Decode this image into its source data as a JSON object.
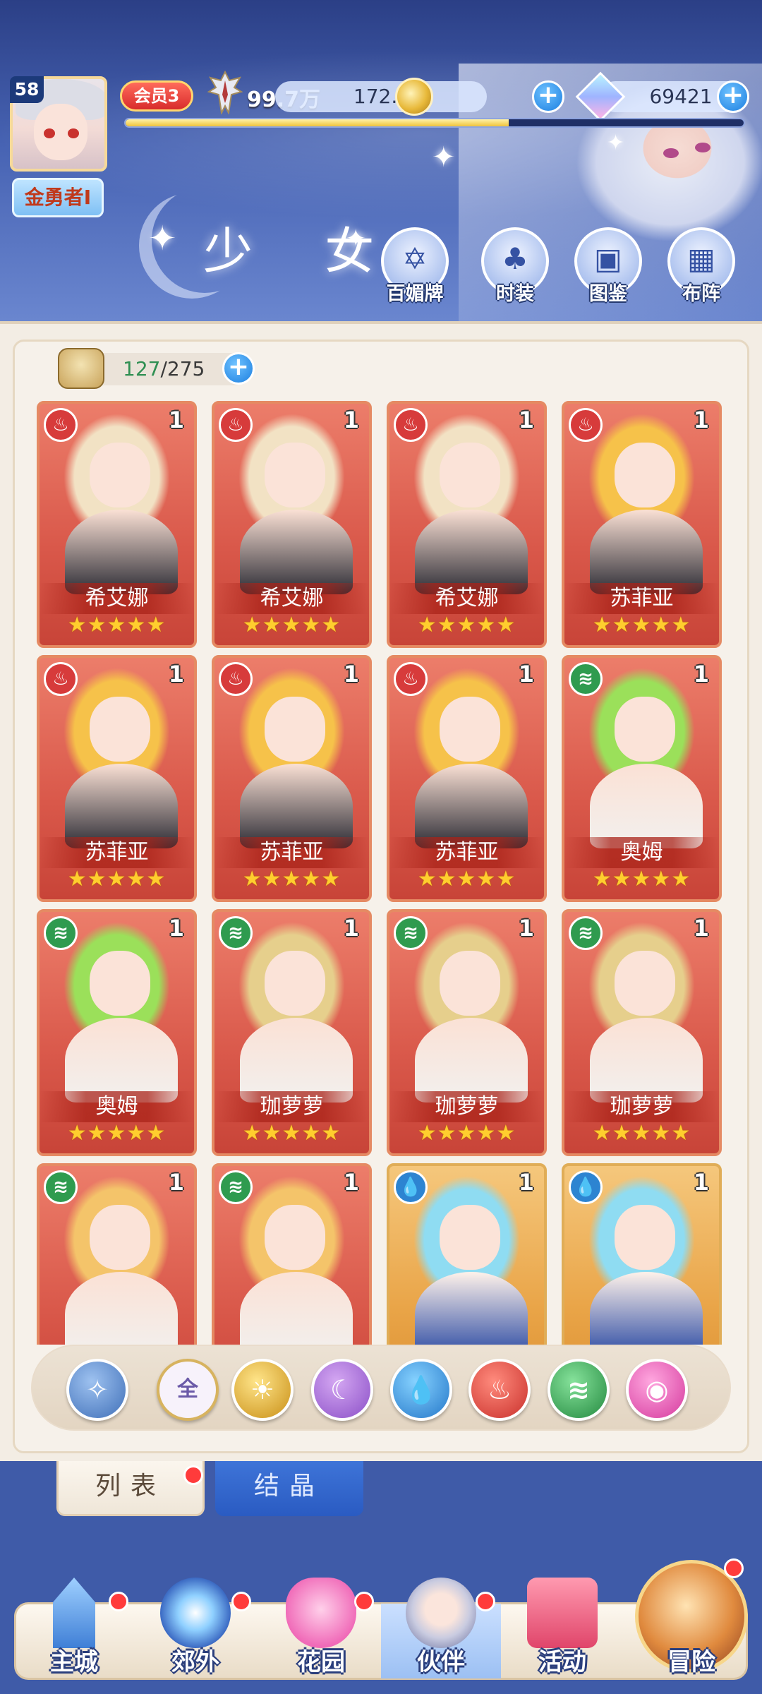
{
  "player": {
    "level": "58",
    "name": "金勇者I",
    "vip": "会员3",
    "power": "99.7万",
    "xp_fraction": 0.62
  },
  "currency": {
    "gold": "172.5万",
    "gems": "69421"
  },
  "section_title": "少 女",
  "features": [
    {
      "label": "百媚牌",
      "icon": "card-deck-icon"
    },
    {
      "label": "时装",
      "icon": "outfit-icon"
    },
    {
      "label": "图鉴",
      "icon": "album-icon"
    },
    {
      "label": "布阵",
      "icon": "formation-icon"
    }
  ],
  "inventory": {
    "current": "127",
    "max": "/275"
  },
  "cards": [
    {
      "name": "希艾娜",
      "element": "fire",
      "count": "1",
      "stars": "★★★★★",
      "style": "red",
      "hair": "#f2e2c4"
    },
    {
      "name": "希艾娜",
      "element": "fire",
      "count": "1",
      "stars": "★★★★★",
      "style": "red",
      "hair": "#f2e2c4"
    },
    {
      "name": "希艾娜",
      "element": "fire",
      "count": "1",
      "stars": "★★★★★",
      "style": "red",
      "hair": "#f2e2c4"
    },
    {
      "name": "苏菲亚",
      "element": "fire",
      "count": "1",
      "stars": "★★★★★",
      "style": "red",
      "hair": "#f6c24a"
    },
    {
      "name": "苏菲亚",
      "element": "fire",
      "count": "1",
      "stars": "★★★★★",
      "style": "red",
      "hair": "#f6c24a"
    },
    {
      "name": "苏菲亚",
      "element": "fire",
      "count": "1",
      "stars": "★★★★★",
      "style": "red",
      "hair": "#f6c24a"
    },
    {
      "name": "苏菲亚",
      "element": "fire",
      "count": "1",
      "stars": "★★★★★",
      "style": "red",
      "hair": "#f6c24a"
    },
    {
      "name": "奥姆",
      "element": "wind",
      "count": "1",
      "stars": "★★★★★",
      "style": "red",
      "hair": "#9be05a"
    },
    {
      "name": "奥姆",
      "element": "wind",
      "count": "1",
      "stars": "★★★★★",
      "style": "red",
      "hair": "#9be05a"
    },
    {
      "name": "珈萝萝",
      "element": "wind",
      "count": "1",
      "stars": "★★★★★",
      "style": "red",
      "hair": "#e6cf8c"
    },
    {
      "name": "珈萝萝",
      "element": "wind",
      "count": "1",
      "stars": "★★★★★",
      "style": "red",
      "hair": "#e6cf8c"
    },
    {
      "name": "珈萝萝",
      "element": "wind",
      "count": "1",
      "stars": "★★★★★",
      "style": "red",
      "hair": "#e6cf8c"
    },
    {
      "name": "",
      "element": "wind",
      "count": "1",
      "stars": "",
      "style": "red",
      "hair": "#f4c46a"
    },
    {
      "name": "",
      "element": "wind",
      "count": "1",
      "stars": "",
      "style": "red",
      "hair": "#f4c46a"
    },
    {
      "name": "",
      "element": "water",
      "count": "1",
      "stars": "",
      "style": "gold",
      "hair": "#8fdcf2"
    },
    {
      "name": "",
      "element": "water",
      "count": "1",
      "stars": "",
      "style": "gold",
      "hair": "#8fdcf2"
    }
  ],
  "filters": {
    "all_label": "全"
  },
  "tabs": {
    "list": "列表",
    "crystal": "结晶"
  },
  "nav": [
    {
      "label": "主城",
      "icon": "castle-icon",
      "badge": true
    },
    {
      "label": "郊外",
      "icon": "portal-icon",
      "badge": true
    },
    {
      "label": "花园",
      "icon": "heart-garden-icon",
      "badge": true
    },
    {
      "label": "伙伴",
      "icon": "partner-icon",
      "badge": true,
      "active": true
    },
    {
      "label": "活动",
      "icon": "gift-icon",
      "badge": false
    },
    {
      "label": "冒险",
      "icon": "adventure-icon",
      "badge": true
    }
  ],
  "colors": {
    "header_blue": "#4763b3",
    "card_red": "#d9584a",
    "card_gold": "#e9a447",
    "star": "#ffce2e"
  }
}
